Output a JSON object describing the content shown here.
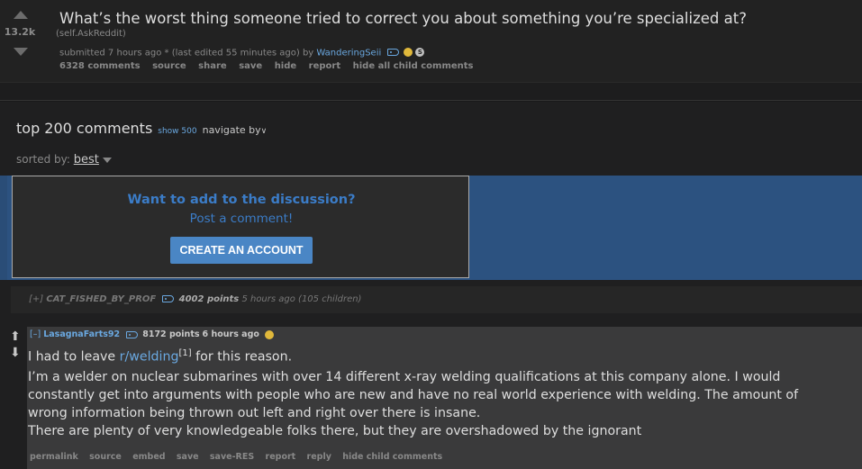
{
  "post": {
    "score": "13.2k",
    "title": "What’s the worst thing someone tried to correct you about something you’re specialized at?",
    "domain": "(self.AskReddit)",
    "submitted": "submitted 7 hours ago * (last edited 55 minutes ago) by",
    "author": "WanderingSeii",
    "coin_label": "S",
    "buttons": [
      "6328 comments",
      "source",
      "share",
      "save",
      "hide",
      "report",
      "hide all child comments"
    ]
  },
  "comments_header": {
    "title": "top 200 comments",
    "show_more": "show 500",
    "navigate": "navigate by",
    "sorted_label": "sorted by:",
    "sort_value": "best"
  },
  "signup": {
    "question": "Want to add to the discussion?",
    "post_link": "Post a comment!",
    "button": "CREATE AN ACCOUNT"
  },
  "collapsed_comment": {
    "expand": "[+]",
    "author": "CAT_FISHED_BY_PROF",
    "points": "4002 points",
    "meta": "5 hours ago (105 children)"
  },
  "comment": {
    "expand": "[–]",
    "author": "LasagnaFarts92",
    "points": "8172 points",
    "time": "6 hours ago",
    "p1_before": "I had to leave ",
    "p1_link": "r/welding",
    "p1_sup": "[1]",
    "p1_after": " for this reason.",
    "p2": "I’m a welder on nuclear submarines with over 14 different x-ray welding qualifications at this company alone. I would constantly get into arguments with people who are new and have no real world experience with welding. The amount of wrong information being thrown out left and right over there is insane.",
    "p3": "There are plenty of very knowledgeable folks there, but they are overshadowed by the ignorant",
    "buttons": [
      "permalink",
      "source",
      "embed",
      "save",
      "save-RES",
      "report",
      "reply",
      "hide child comments"
    ]
  }
}
